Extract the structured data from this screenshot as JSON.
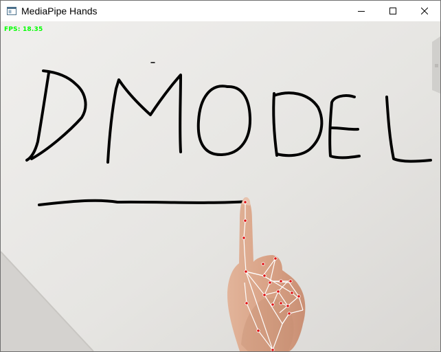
{
  "window": {
    "title": "MediaPipe Hands",
    "app_icon": "window-app-icon",
    "controls": {
      "minimize_icon": "minimize-icon",
      "maximize_icon": "maximize-icon",
      "close_icon": "close-icon"
    }
  },
  "overlay": {
    "fps_text": "FPS: 18.35",
    "fps_color": "#00ff00"
  },
  "drawing": {
    "ink_color": "#000000"
  },
  "hand_tracking": {
    "landmark_color": "#e01010",
    "connection_color": "#ffffff"
  }
}
